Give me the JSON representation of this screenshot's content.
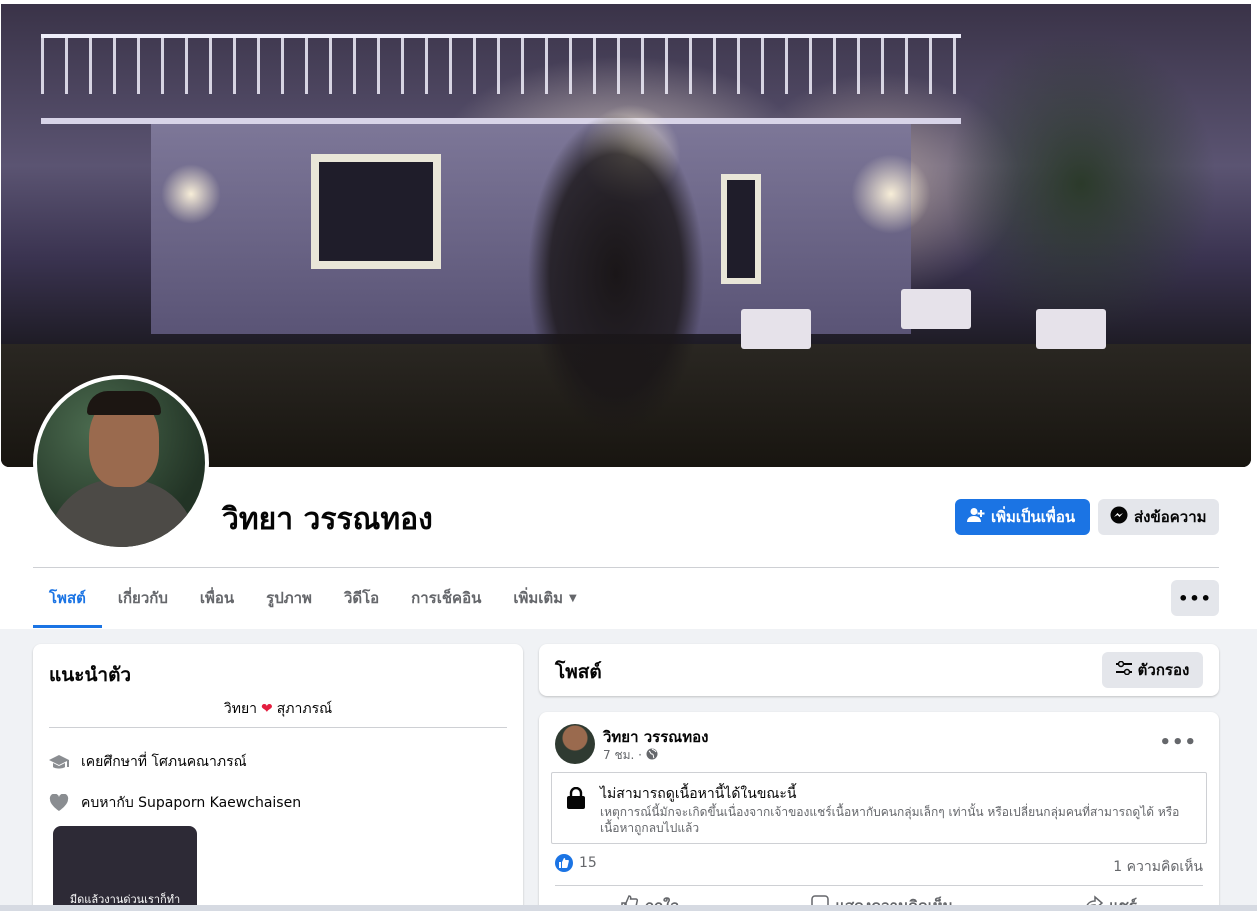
{
  "profile": {
    "name": "วิทยา วรรณทอง",
    "add_friend_label": "เพิ่มเป็นเพื่อน",
    "message_label": "ส่งข้อความ"
  },
  "tabs": [
    {
      "label": "โพสต์",
      "active": true
    },
    {
      "label": "เกี่ยวกับ",
      "active": false
    },
    {
      "label": "เพื่อน",
      "active": false
    },
    {
      "label": "รูปภาพ",
      "active": false
    },
    {
      "label": "วิดีโอ",
      "active": false
    },
    {
      "label": "การเช็คอิน",
      "active": false
    },
    {
      "label": "เพิ่มเติม",
      "active": false
    }
  ],
  "more_button": "•••",
  "intro": {
    "title": "แนะนำตัว",
    "bio_left": "วิทยา",
    "bio_heart": "❤",
    "bio_right": "สุภาภรณ์",
    "education": "เคยศึกษาที่ โศภนคณาภรณ์",
    "relationship": "คบหากับ Supaporn Kaewchaisen",
    "featured_caption": "มีดแล้วงานด่วนเราก็ทำ"
  },
  "posts_header": {
    "title": "โพสต์",
    "filter_label": "ตัวกรอง"
  },
  "post": {
    "author": "วิทยา วรรณทอง",
    "time": "7 ชม. ·",
    "more": "•••",
    "locked_title": "ไม่สามารถดูเนื้อหานี้ได้ในขณะนี้",
    "locked_desc": "เหตุการณ์นี้มักจะเกิดขึ้นเนื่องจากเจ้าของแชร์เนื้อหากับคนกลุ่มเล็กๆ เท่านั้น หรือเปลี่ยนกลุ่มคนที่สามารถดูได้ หรือเนื้อหาถูกลบไปแล้ว",
    "likes": "15",
    "comments": "1 ความคิดเห็น",
    "action_like": "ถูกใจ",
    "action_comment": "แสดงความคิดเห็น",
    "action_share": "แชร์"
  },
  "colors": {
    "accent": "#1b74e4",
    "heart": "#e41e3f",
    "secondary_text": "#65676b"
  }
}
